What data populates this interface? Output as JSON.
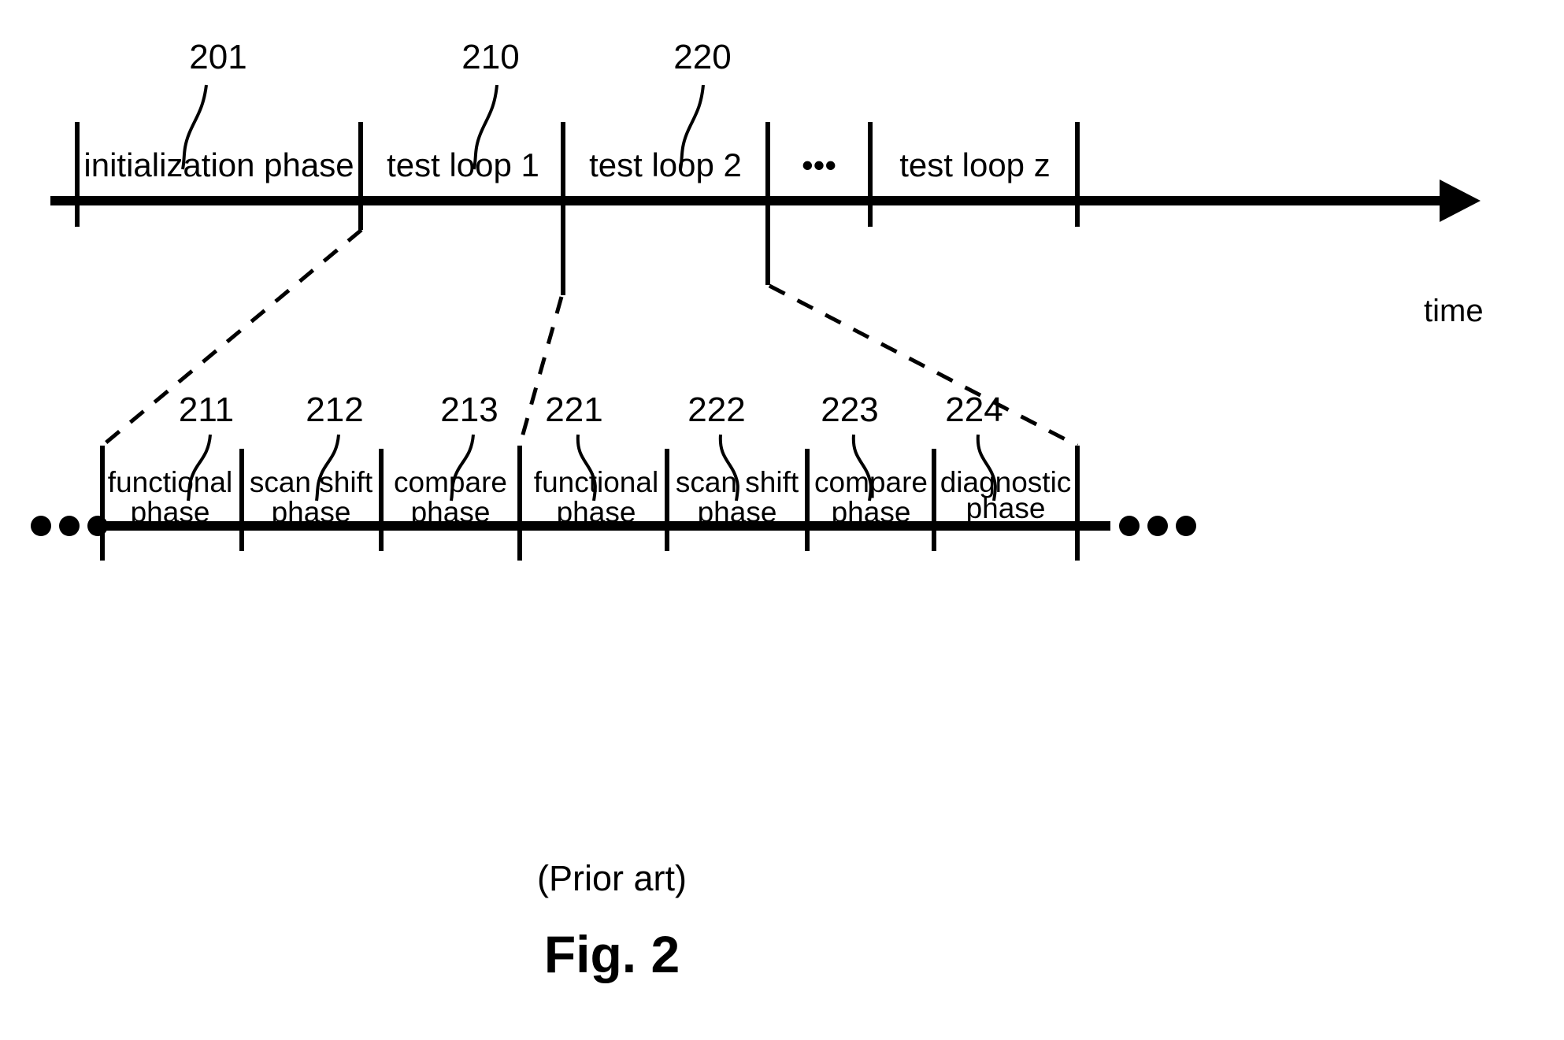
{
  "figure": {
    "caption_prior_art": "(Prior art)",
    "caption_number": "Fig. 2",
    "time_axis_label": "time"
  },
  "top_timeline": {
    "reference_numbers": [
      {
        "id": "201",
        "label": "201"
      },
      {
        "id": "210",
        "label": "210"
      },
      {
        "id": "220",
        "label": "220"
      }
    ],
    "segments": [
      {
        "label": "initialization phase",
        "ref": "201"
      },
      {
        "label": "test loop 1",
        "ref": "210"
      },
      {
        "label": "test loop 2",
        "ref": "220"
      },
      {
        "label": "•••",
        "ref": ""
      },
      {
        "label": "test loop z",
        "ref": ""
      }
    ],
    "ellipsis_label": "•••"
  },
  "bottom_timeline": {
    "leading_ellipsis": "•••",
    "trailing_ellipsis": "•••",
    "reference_numbers": [
      "211",
      "212",
      "213",
      "221",
      "222",
      "223",
      "224"
    ],
    "segments": [
      {
        "ref": "211",
        "line1": "functional",
        "line2": "phase"
      },
      {
        "ref": "212",
        "line1": "scan shift",
        "line2": "phase"
      },
      {
        "ref": "213",
        "line1": "compare",
        "line2": "phase"
      },
      {
        "ref": "221",
        "line1": "functional",
        "line2": "phase"
      },
      {
        "ref": "222",
        "line1": "scan shift",
        "line2": "phase"
      },
      {
        "ref": "223",
        "line1": "compare",
        "line2": "phase"
      },
      {
        "ref": "224",
        "line1": "diagnostic",
        "line2": "phase"
      }
    ]
  },
  "colors": {
    "ink": "#000000",
    "background": "#ffffff"
  }
}
